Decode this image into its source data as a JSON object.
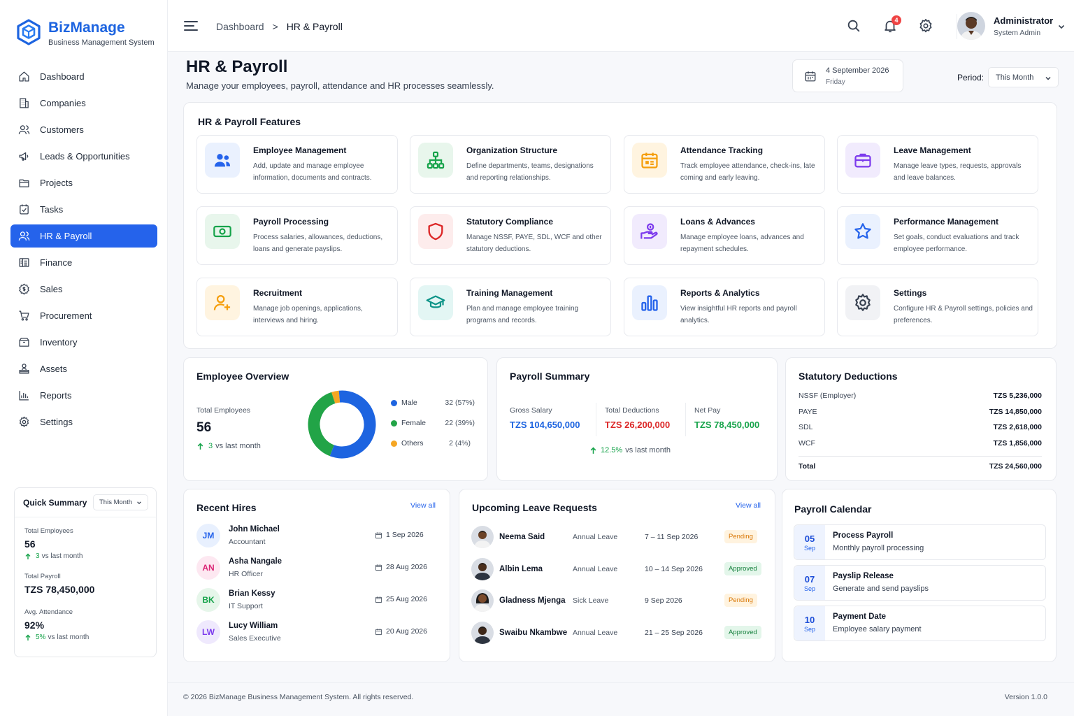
{
  "brand": {
    "name": "BizManage",
    "tagline": "Business Management System"
  },
  "sidebar": {
    "items": [
      {
        "label": "Dashboard"
      },
      {
        "label": "Companies"
      },
      {
        "label": "Customers"
      },
      {
        "label": "Leads & Opportunities"
      },
      {
        "label": "Projects"
      },
      {
        "label": "Tasks"
      },
      {
        "label": "HR & Payroll",
        "active": true
      },
      {
        "label": "Finance"
      },
      {
        "label": "Sales"
      },
      {
        "label": "Procurement"
      },
      {
        "label": "Inventory"
      },
      {
        "label": "Assets"
      },
      {
        "label": "Reports"
      },
      {
        "label": "Settings"
      }
    ],
    "quick_summary": {
      "title": "Quick Summary",
      "period": "This Month",
      "total_employees_label": "Total Employees",
      "total_employees_value": "56",
      "total_employees_trend": "3",
      "total_employees_trend_text": "vs last month",
      "total_payroll_label": "Total Payroll",
      "total_payroll_value": "TZS 78,450,000",
      "attendance_label": "Avg. Attendance",
      "attendance_value": "92%",
      "attendance_trend": "5%",
      "attendance_trend_text": "vs last month"
    }
  },
  "header": {
    "breadcrumb": [
      "Dashboard",
      "HR & Payroll"
    ],
    "notification_count": "4",
    "user": {
      "name": "Administrator",
      "role": "System Admin"
    }
  },
  "page": {
    "title": "HR & Payroll",
    "subtitle": "Manage your employees, payroll, attendance and HR processes seamlessly.",
    "date_line1": "4 September 2026",
    "date_line2": "Friday",
    "period_label": "Period:",
    "period_value": "This Month"
  },
  "features": {
    "title": "HR & Payroll Features",
    "items": [
      {
        "title": "Employee Management",
        "desc": "Add, update and manage employee information, documents and contracts.",
        "icon": "users-icon",
        "color": "#2563eb",
        "bg": "#eaf1fe"
      },
      {
        "title": "Organization Structure",
        "desc": "Define departments, teams, designations and reporting relationships.",
        "icon": "org-chart-icon",
        "color": "#16a34a",
        "bg": "#e8f6ec"
      },
      {
        "title": "Attendance Tracking",
        "desc": "Track employee attendance, check-ins, late coming and early leaving.",
        "icon": "calendar-icon",
        "color": "#f59e0b",
        "bg": "#fff4e0"
      },
      {
        "title": "Leave Management",
        "desc": "Manage leave types, requests, approvals and leave balances.",
        "icon": "briefcase-icon",
        "color": "#7c3aed",
        "bg": "#f1ebfd"
      },
      {
        "title": "Payroll Processing",
        "desc": "Process salaries, allowances, deductions, loans and generate payslips.",
        "icon": "banknote-icon",
        "color": "#16a34a",
        "bg": "#e8f6ec"
      },
      {
        "title": "Statutory Compliance",
        "desc": "Manage NSSF, PAYE, SDL, WCF and other statutory deductions.",
        "icon": "shield-icon",
        "color": "#dc2626",
        "bg": "#fdecec"
      },
      {
        "title": "Loans & Advances",
        "desc": "Manage employee loans, advances and repayment schedules.",
        "icon": "hand-coin-icon",
        "color": "#7c3aed",
        "bg": "#f1ebfd"
      },
      {
        "title": "Performance Management",
        "desc": "Set goals, conduct evaluations and track employee performance.",
        "icon": "star-icon",
        "color": "#2563eb",
        "bg": "#eaf1fe"
      },
      {
        "title": "Recruitment",
        "desc": "Manage job openings, applications, interviews and hiring.",
        "icon": "user-add-icon",
        "color": "#f59e0b",
        "bg": "#fff4e0"
      },
      {
        "title": "Training Management",
        "desc": "Plan and manage employee training programs and records.",
        "icon": "graduation-cap-icon",
        "color": "#0d9488",
        "bg": "#e3f6f4"
      },
      {
        "title": "Reports & Analytics",
        "desc": "View insightful HR reports and payroll analytics.",
        "icon": "bar-chart-icon",
        "color": "#2563eb",
        "bg": "#eaf1fe"
      },
      {
        "title": "Settings",
        "desc": "Configure HR & Payroll settings, policies and preferences.",
        "icon": "gear-icon",
        "color": "#374151",
        "bg": "#f1f2f5"
      }
    ]
  },
  "employee_overview": {
    "title": "Employee Overview",
    "total_label": "Total Employees",
    "total_value": "56",
    "trend_value": "3",
    "trend_text": "vs last month",
    "legend": [
      {
        "label": "Male",
        "value": "32 (57%)",
        "count": 32,
        "color": "#1d64e0"
      },
      {
        "label": "Female",
        "value": "22 (39%)",
        "count": 22,
        "color": "#22a447"
      },
      {
        "label": "Others",
        "value": "2 (4%)",
        "count": 2,
        "color": "#f5a623"
      }
    ]
  },
  "payroll_summary": {
    "title": "Payroll Summary",
    "gross_label": "Gross Salary",
    "gross_value": "TZS 104,650,000",
    "deductions_label": "Total Deductions",
    "deductions_value": "TZS 26,200,000",
    "net_label": "Net Pay",
    "net_value": "TZS 78,450,000",
    "trend_value": "12.5%",
    "trend_text": "vs last month",
    "colors": {
      "gross": "#1d64e0",
      "deductions": "#dc2626",
      "net": "#16a34a"
    }
  },
  "statutory": {
    "title": "Statutory Deductions",
    "rows": [
      {
        "label": "NSSF (Employer)",
        "value": "TZS 5,236,000"
      },
      {
        "label": "PAYE",
        "value": "TZS 14,850,000"
      },
      {
        "label": "SDL",
        "value": "TZS 2,618,000"
      },
      {
        "label": "WCF",
        "value": "TZS 1,856,000"
      }
    ],
    "total_label": "Total",
    "total_value": "TZS 24,560,000"
  },
  "recent_hires": {
    "title": "Recent Hires",
    "view_all": "View all",
    "rows": [
      {
        "initials": "JM",
        "name": "John Michael",
        "role": "Accountant",
        "date": "1 Sep 2026",
        "color": "#2563eb",
        "bg": "#e8f0fe"
      },
      {
        "initials": "AN",
        "name": "Asha Nangale",
        "role": "HR Officer",
        "date": "28 Aug 2026",
        "color": "#db2777",
        "bg": "#fde8f1"
      },
      {
        "initials": "BK",
        "name": "Brian Kessy",
        "role": "IT Support",
        "date": "25 Aug 2026",
        "color": "#16a34a",
        "bg": "#e6f6ea"
      },
      {
        "initials": "LW",
        "name": "Lucy William",
        "role": "Sales Executive",
        "date": "20 Aug 2026",
        "color": "#7c3aed",
        "bg": "#efe9fd"
      }
    ]
  },
  "leave_requests": {
    "title": "Upcoming Leave Requests",
    "view_all": "View all",
    "rows": [
      {
        "name": "Neema Said",
        "type": "Annual Leave",
        "dates": "7 – 11 Sep 2026",
        "status": "Pending"
      },
      {
        "name": "Albin Lema",
        "type": "Annual Leave",
        "dates": "10 – 14 Sep 2026",
        "status": "Approved"
      },
      {
        "name": "Gladness Mjenga",
        "type": "Sick Leave",
        "dates": "9 Sep 2026",
        "status": "Pending"
      },
      {
        "name": "Swaibu Nkambwe",
        "type": "Annual Leave",
        "dates": "21 – 25 Sep 2026",
        "status": "Approved"
      }
    ]
  },
  "payroll_calendar": {
    "title": "Payroll Calendar",
    "items": [
      {
        "day": "05",
        "month": "Sep",
        "title": "Process Payroll",
        "desc": "Monthly payroll processing"
      },
      {
        "day": "07",
        "month": "Sep",
        "title": "Payslip Release",
        "desc": "Generate and send payslips"
      },
      {
        "day": "10",
        "month": "Sep",
        "title": "Payment Date",
        "desc": "Employee salary payment"
      }
    ]
  },
  "footer": {
    "copyright": "© 2026 BizManage Business Management System. All rights reserved.",
    "version": "Version 1.0.0"
  }
}
